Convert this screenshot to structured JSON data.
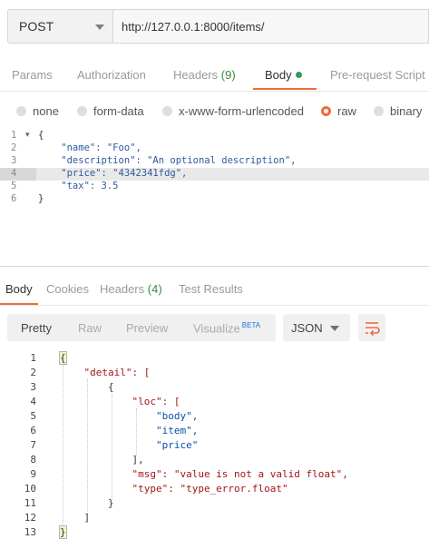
{
  "request": {
    "method": "POST",
    "url": "http://127.0.0.1:8000/items/"
  },
  "request_tabs": [
    {
      "label": "Params"
    },
    {
      "label": "Authorization"
    },
    {
      "label": "Headers",
      "count": "(9)"
    },
    {
      "label": "Body"
    },
    {
      "label": "Pre-request Script"
    }
  ],
  "body_types": [
    "none",
    "form-data",
    "x-www-form-urlencoded",
    "raw",
    "binary"
  ],
  "body_selected": "raw",
  "request_body": {
    "line_numbers": [
      "1",
      "2",
      "3",
      "4",
      "5",
      "6"
    ],
    "lines": [
      "{",
      "    \"name\": \"Foo\",",
      "    \"description\": \"An optional description\",",
      "    \"price\": \"4342341fdg\",",
      "    \"tax\": 3.5",
      "}"
    ]
  },
  "response_tabs": [
    {
      "label": "Body"
    },
    {
      "label": "Cookies"
    },
    {
      "label": "Headers",
      "count": "(4)"
    },
    {
      "label": "Test Results"
    }
  ],
  "response_views": [
    "Pretty",
    "Raw",
    "Preview",
    "Visualize"
  ],
  "beta_label": "BETA",
  "format": "JSON",
  "response_body": {
    "line_numbers": [
      "1",
      "2",
      "3",
      "4",
      "5",
      "6",
      "7",
      "8",
      "9",
      "10",
      "11",
      "12",
      "13"
    ],
    "lines": [
      "{",
      "    \"detail\": [",
      "        {",
      "            \"loc\": [",
      "                \"body\",",
      "                \"item\",",
      "                \"price\"",
      "            ],",
      "            \"msg\": \"value is not a valid float\",",
      "            \"type\": \"type_error.float\"",
      "        }",
      "    ]",
      "}"
    ]
  },
  "colors": {
    "accent": "#f26b3a",
    "active_dot": "#2e9e4f",
    "json_key": "#a31515",
    "json_string": "#0451a5"
  }
}
